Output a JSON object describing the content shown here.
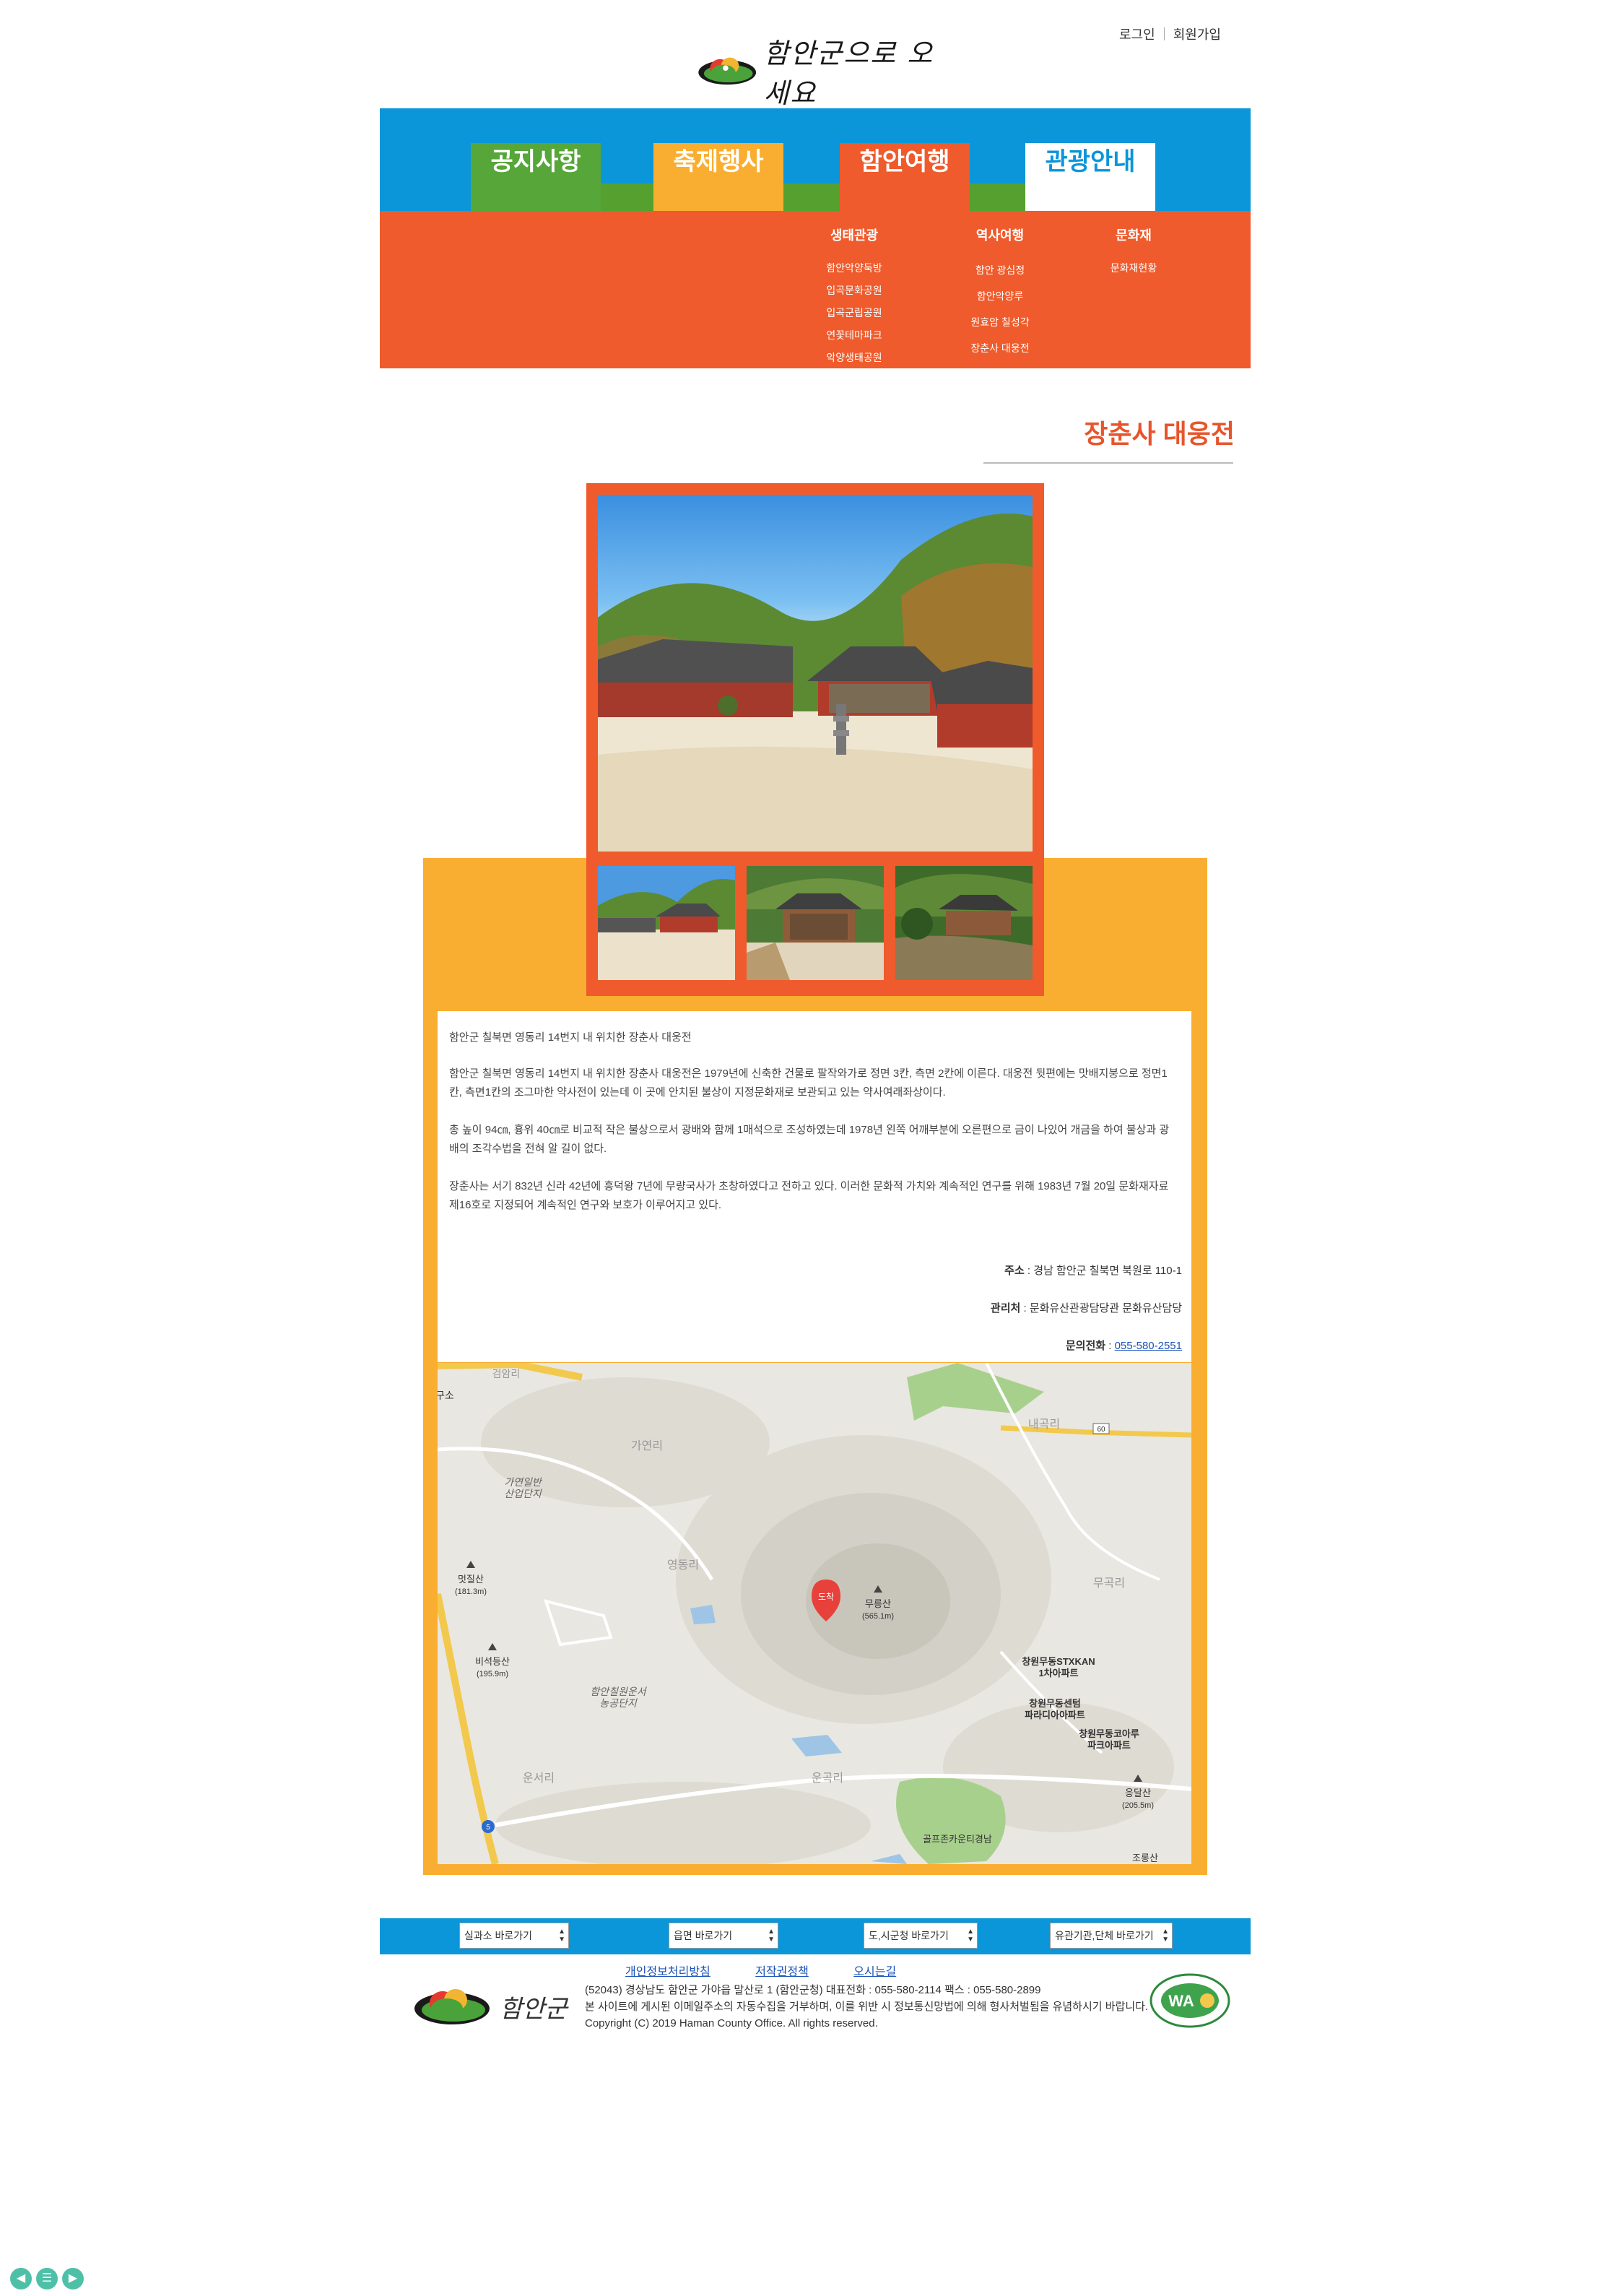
{
  "header": {
    "login": "로그인",
    "signup": "회원가입",
    "logo_text": "함안군으로 오세요"
  },
  "nav": {
    "tabs": [
      {
        "label": "공지사항"
      },
      {
        "label": "축제행사"
      },
      {
        "label": "함안여행"
      },
      {
        "label": "관광안내"
      }
    ],
    "active_tab": "함안여행",
    "submenu": [
      {
        "heading": "생태관광",
        "items": [
          "함안악양둑방",
          "입곡문화공원",
          "입곡군립공원",
          "연꽃테마파크",
          "악양생태공원"
        ]
      },
      {
        "heading": "역사여행",
        "items": [
          "함안 광심정",
          "함안악양루",
          "원효암 칠성각",
          "장춘사 대웅전"
        ]
      },
      {
        "heading": "문화재",
        "items": [
          "문화재현황"
        ]
      }
    ]
  },
  "page": {
    "title": "장춘사 대웅전",
    "paragraphs": [
      "함안군 칠북면 영동리 14번지 내 위치한 장춘사 대웅전",
      "함안군 칠북면 영동리 14번지 내 위치한 장춘사 대웅전은 1979년에 신축한 건물로 팔작와가로 정면 3칸, 측면 2칸에 이른다. 대웅전 뒷편에는 맛배지붕으로 정면1칸, 측면1칸의 조그마한 약사전이 있는데 이 곳에 안치된 불상이 지정문화재로 보관되고 있는 약사여래좌상이다.",
      "총 높이 94㎝, 흉위 40㎝로 비교적 작은 불상으로서 광배와 함께 1매석으로 조성하였는데 1978년 왼쪽 어깨부분에 오른편으로 금이 나있어 개금을 하여 불상과 광배의 조각수법을 전혀 알 길이 없다.",
      "장춘사는 서기 832년 신라 42년에 흥덕왕 7년에 무량국사가 초창하였다고 전하고 있다. 이러한 문화적 가치와 계속적인 연구를 위해 1983년 7월 20일 문화재자료 제16호로 지정되어 계속적인 연구와 보호가 이루어지고 있다."
    ],
    "address_label": "주소",
    "address": " : 경남 함안군 칠북면 북원로 110-1",
    "manager_label": "관리처",
    "manager": " : 문화유산관광담당관 문화유산담당",
    "phone_label": "문의전화",
    "phone": "055-580-2551"
  },
  "map": {
    "marker_label": "도착",
    "labels": {
      "mountain1": "무릉산",
      "mountain1_h": "(565.1m)",
      "mountain2": "멋질산",
      "mountain2_h": "(181.3m)",
      "mountain3": "비석등산",
      "mountain3_h": "(195.9m)",
      "mountain4": "응달산",
      "mountain4_h": "(205.5m)",
      "mountain5": "조롱산",
      "village1": "영동리",
      "village2": "가연리",
      "village3": "운서리",
      "village4": "운곡리",
      "village5": "내곡리",
      "village6": "무곡리",
      "village7": "검암리",
      "ind1a": "가연일반",
      "ind1b": "산업단지",
      "ind2a": "함안칠원운서",
      "ind2b": "농공단지",
      "apt1a": "창원무동STXKAN",
      "apt1b": "1차아파트",
      "apt2a": "창원무동센텀",
      "apt2b": "파라디아아파트",
      "apt3a": "창원무동코아루",
      "apt3b": "파크아파트",
      "golf": "골프존카운티경남",
      "road60": "60",
      "road5": "5",
      "corner": "구소"
    }
  },
  "footer": {
    "selects": [
      "실과소 바로가기",
      "읍면 바로가기",
      "도,시군청 바로가기",
      "유관기관,단체 바로가기"
    ],
    "links": [
      "개인정보처리방침",
      "저작권정책",
      "오시는길"
    ],
    "address_line": "(52043) 경상남도 함안군 가야읍 말산로 1 (함안군청)     대표전화 : 055-580-2114     팩스 : 055-580-2899",
    "notice_line": "본 사이트에 게시된 이메일주소의 자동수집을 거부하며, 이를 위반 시 정보통신망법에 의해 형사처벌됨을 유념하시기 바랍니다.",
    "copyright": "Copyright (C) 2019 Haman County Office. All rights reserved.",
    "logo_text": "함안군",
    "badge_text": "WA"
  },
  "colors": {
    "blue": "#0a96d8",
    "green": "#56a639",
    "yellow": "#f9ae32",
    "orange": "#ef5b2c"
  }
}
